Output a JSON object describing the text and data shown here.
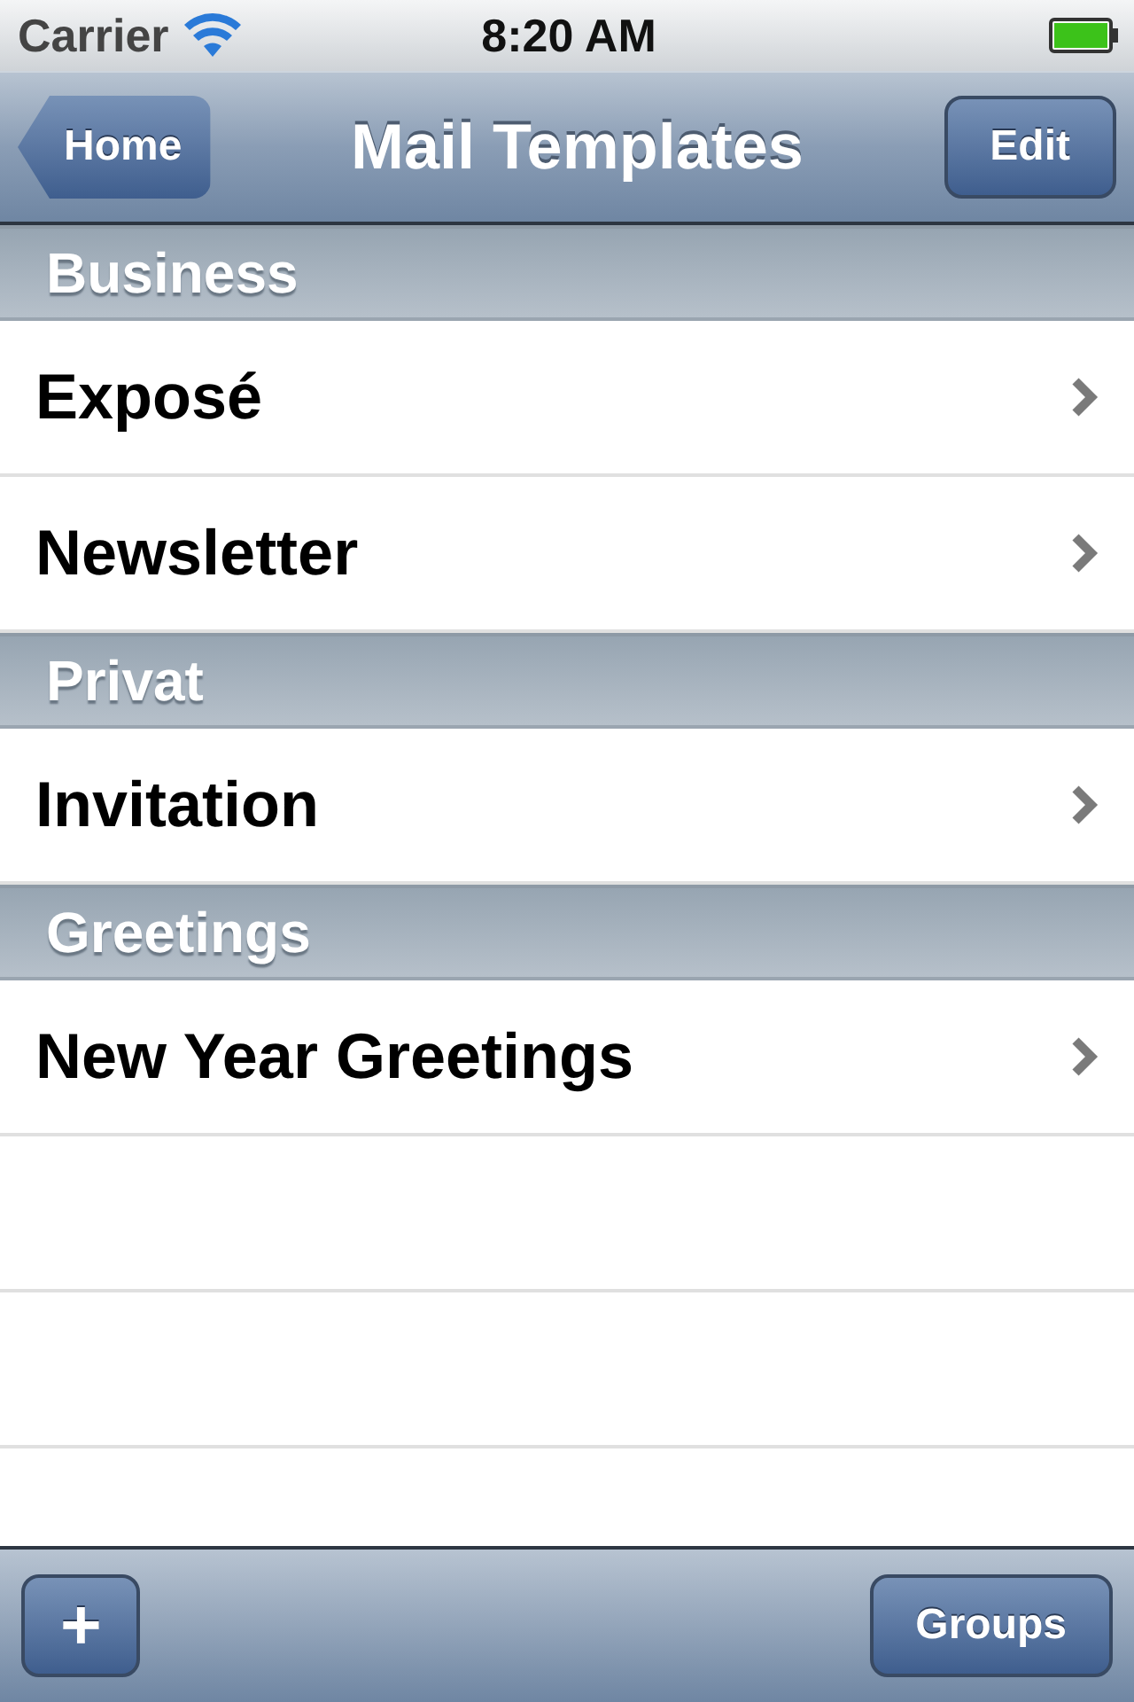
{
  "status_bar": {
    "carrier": "Carrier",
    "time": "8:20 AM"
  },
  "nav_bar": {
    "back_button": "Home",
    "title": "Mail Templates",
    "edit_button": "Edit"
  },
  "sections": [
    {
      "header": "Business",
      "rows": [
        {
          "label": "Exposé"
        },
        {
          "label": "Newsletter"
        }
      ]
    },
    {
      "header": "Privat",
      "rows": [
        {
          "label": "Invitation"
        }
      ]
    },
    {
      "header": "Greetings",
      "rows": [
        {
          "label": "New Year Greetings"
        }
      ]
    }
  ],
  "toolbar": {
    "add_button": "+",
    "groups_button": "Groups"
  }
}
